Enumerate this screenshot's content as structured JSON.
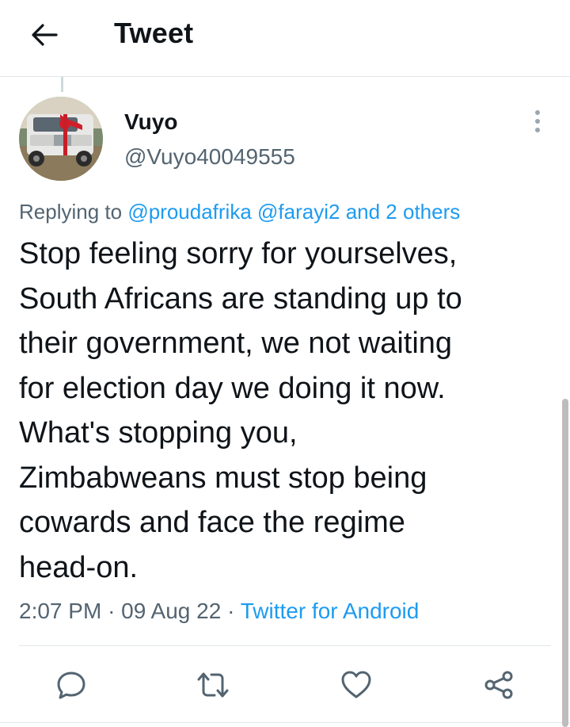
{
  "header": {
    "title": "Tweet",
    "back_icon": "arrow-left-icon"
  },
  "tweet": {
    "author": {
      "name": "Vuyo",
      "handle": "@Vuyo40049555"
    },
    "replying": {
      "prefix": "Replying to",
      "mentions": [
        "@proudafrika",
        "@farayi2"
      ],
      "others": "and 2 others"
    },
    "text": "Stop feeling sorry for yourselves,\nSouth Africans are standing up to\ntheir government, we not waiting\nfor election day we doing it now.\nWhat's stopping you,\nZimbabweans must stop being\ncowards and face the regime\nhead-on.",
    "time": "2:07 PM",
    "separator": "·",
    "date": "09 Aug 22",
    "source": "Twitter for Android"
  },
  "actions": [
    "reply-icon",
    "retweet-icon",
    "like-icon",
    "share-icon"
  ],
  "colors": {
    "link": "#1d9bf0",
    "secondary": "#536471",
    "text": "#0f1419",
    "divider": "#e1e6ea"
  }
}
